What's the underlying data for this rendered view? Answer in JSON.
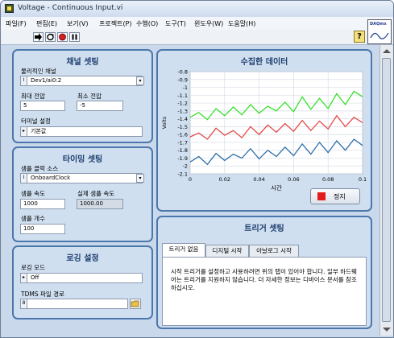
{
  "window": {
    "title": "Voltage - Continuous Input.vi"
  },
  "menu": [
    "파일(F)",
    "편집(E)",
    "보기(V)",
    "프로젝트(P)",
    "수행(O)",
    "도구(T)",
    "윈도우(W)",
    "도움말(H)"
  ],
  "toolbar": {
    "run_icon": "run-arrow",
    "continuous_icon": "run-continuous",
    "abort_icon": "abort-circle",
    "pause_icon": "pause-bars",
    "help_label": "?"
  },
  "vi_icon_text": "DAQmx",
  "channel_panel": {
    "title": "채널 셋팅",
    "physical_channel_label": "물리적인 채널",
    "physical_channel_value": "Dev1/ai0:2",
    "max_voltage_label": "최대 전압",
    "max_voltage_value": "5",
    "min_voltage_label": "최소 전압",
    "min_voltage_value": "-5",
    "terminal_label": "터미널 설정",
    "terminal_value": "기본값"
  },
  "timing_panel": {
    "title": "타이밍 셋팅",
    "clock_source_label": "샘플 클럭 소스",
    "clock_source_value": "OnboardClock",
    "rate_label": "샘플 속도",
    "rate_value": "1000",
    "actual_rate_label": "실제 샘플 속도",
    "actual_rate_value": "1000.00",
    "samples_label": "샘플 개수",
    "samples_value": "100"
  },
  "logging_panel": {
    "title": "로깅 설정",
    "mode_label": "로깅 모드",
    "mode_value": "Off",
    "path_label": "TDMS 파일 경로",
    "path_value": ""
  },
  "graph_panel": {
    "title": "수집한 데이터",
    "stop_label": "정지"
  },
  "trigger_panel": {
    "title": "트리거 셋팅",
    "tabs": [
      "트리거 없음",
      "디지털 시작",
      "아날로그 시작"
    ],
    "message": "시작 트리거를 설정하고 사용하려면 위의 탭이 있어야 합니다.  일부 하드웨어는 트리거를 지원하지 않습니다. 더 자세한 정보는 디바이스 문서를 참조하십시오."
  },
  "chart_data": {
    "type": "line",
    "xlabel": "시간",
    "ylabel": "Volts",
    "xlim": [
      0,
      0.1
    ],
    "ylim": [
      -2.1,
      -0.8
    ],
    "x_ticks": [
      "0",
      "0.02",
      "0.04",
      "0.06",
      "0.08",
      "0.1"
    ],
    "y_ticks": [
      "-0.8",
      "-0.9",
      "-1",
      "-1.1",
      "-1.2",
      "-1.3",
      "-1.4",
      "-1.5",
      "-1.6",
      "-1.7",
      "-1.8",
      "-1.9",
      "-2",
      "-2.1"
    ],
    "grid": true,
    "series": [
      {
        "color": "#37e02a",
        "x": [
          0,
          0.005,
          0.01,
          0.015,
          0.02,
          0.025,
          0.03,
          0.035,
          0.04,
          0.045,
          0.05,
          0.055,
          0.06,
          0.065,
          0.07,
          0.075,
          0.08,
          0.085,
          0.09,
          0.095,
          0.1
        ],
        "values": [
          -1.38,
          -1.32,
          -1.41,
          -1.27,
          -1.36,
          -1.25,
          -1.35,
          -1.22,
          -1.33,
          -1.24,
          -1.3,
          -1.19,
          -1.31,
          -1.12,
          -1.28,
          -1.14,
          -1.27,
          -1.08,
          -1.22,
          -1.05,
          -1.12
        ]
      },
      {
        "color": "#e34747",
        "x": [
          0,
          0.005,
          0.01,
          0.015,
          0.02,
          0.025,
          0.03,
          0.035,
          0.04,
          0.045,
          0.05,
          0.055,
          0.06,
          0.065,
          0.07,
          0.075,
          0.08,
          0.085,
          0.09,
          0.095,
          0.1
        ],
        "values": [
          -1.63,
          -1.58,
          -1.66,
          -1.52,
          -1.61,
          -1.55,
          -1.64,
          -1.5,
          -1.6,
          -1.48,
          -1.57,
          -1.46,
          -1.56,
          -1.42,
          -1.55,
          -1.43,
          -1.53,
          -1.36,
          -1.5,
          -1.38,
          -1.45
        ]
      },
      {
        "color": "#2f6fa8",
        "x": [
          0,
          0.005,
          0.01,
          0.015,
          0.02,
          0.025,
          0.03,
          0.035,
          0.04,
          0.045,
          0.05,
          0.055,
          0.06,
          0.065,
          0.07,
          0.075,
          0.08,
          0.085,
          0.09,
          0.095,
          0.1
        ],
        "values": [
          -1.95,
          -1.88,
          -1.98,
          -1.84,
          -1.93,
          -1.85,
          -1.9,
          -1.78,
          -1.91,
          -1.8,
          -1.88,
          -1.76,
          -1.87,
          -1.72,
          -1.85,
          -1.7,
          -1.83,
          -1.68,
          -1.8,
          -1.66,
          -1.74
        ]
      }
    ]
  }
}
